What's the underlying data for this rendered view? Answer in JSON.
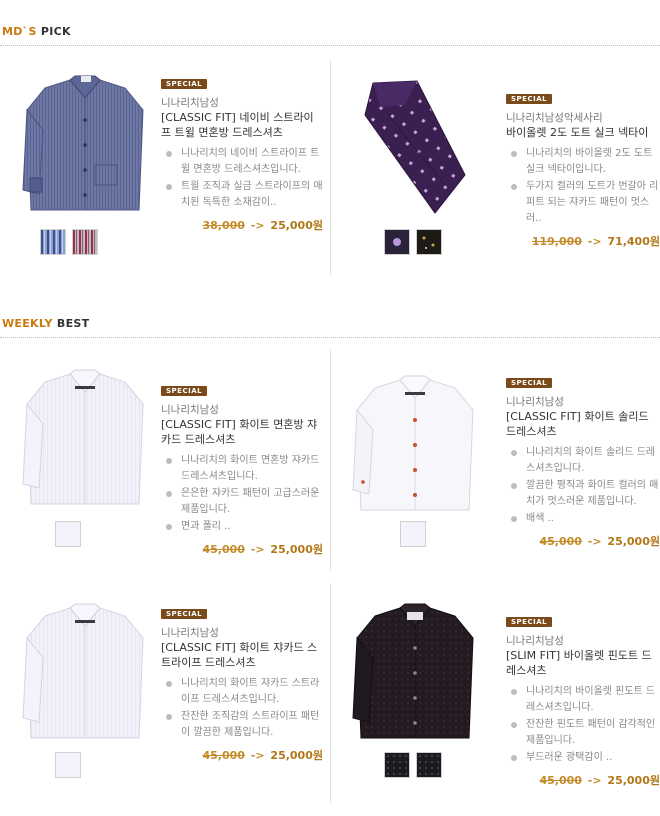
{
  "sections": {
    "mds_pick": {
      "accent": "MD`S",
      "rest": " PICK"
    },
    "weekly_best": {
      "accent": "WEEKLY",
      "rest": " BEST"
    }
  },
  "colors": {
    "accent": "#c8790f",
    "badge_bg": "#7a4a1a",
    "price": "#b17716"
  },
  "mds_pick": [
    {
      "badge": "SPECIAL",
      "brand": "니나리치남성",
      "name": "[CLASSIC FIT] 네이비 스트라이프 트윌 면혼방 드레스셔츠",
      "desc": [
        "니나리치의 네이비 스트라이프 트윌 면혼방 드레스셔츠입니다.",
        "트윌 조직과 실금 스트라이프의 매치된 독특한 소재감이.."
      ],
      "old_price": "38,000",
      "arrow": "->",
      "new_price": "25,000원",
      "image": "navy-stripe-shirt",
      "swatches": [
        "blue-stripe",
        "red-stripe"
      ]
    },
    {
      "badge": "SPECIAL",
      "brand": "니나리치남성악세사리",
      "name": "바이올렛 2도 도트 실크 넥타이",
      "desc": [
        "니나리치의 바이올렛 2도 도트 실크 넥타이입니다.",
        "두가지 컬러의 도트가 번갈아 리피트 되는 쟈카드 패턴이 멋스러.."
      ],
      "old_price": "119,000",
      "arrow": "->",
      "new_price": "71,400원",
      "image": "violet-dot-tie",
      "swatches": [
        "violet-dot",
        "gold-dot"
      ]
    }
  ],
  "weekly_best": [
    {
      "badge": "SPECIAL",
      "brand": "니나리치남성",
      "name": "[CLASSIC FIT] 화이트 면혼방 쟈카드 드레스셔츠",
      "desc": [
        "니나리치의 화이트 면혼방 쟈카드 드레스셔츠입니다.",
        "은은한 쟈카드 패턴이 고급스러운 제품입니다.",
        "면과 폴리 .."
      ],
      "old_price": "45,000",
      "arrow": "->",
      "new_price": "25,000원",
      "image": "white-jacquard-shirt",
      "swatches": [
        "white"
      ]
    },
    {
      "badge": "SPECIAL",
      "brand": "니나리치남성",
      "name": "[CLASSIC FIT] 화이트 솔리드 드레스셔츠",
      "desc": [
        "니나리치의 화이트 솔리드 드레스셔츠입니다.",
        "깔끔한 평직과 화이트 컬러의 매치가 멋스러운 제품입니다.",
        "배색 .."
      ],
      "old_price": "45,000",
      "arrow": "->",
      "new_price": "25,000원",
      "image": "white-solid-shirt",
      "swatches": [
        "white"
      ]
    },
    {
      "badge": "SPECIAL",
      "brand": "니나리치남성",
      "name": "[CLASSIC FIT] 화이트 쟈카드 스트라이프 드레스셔츠",
      "desc": [
        "니나리치의 화이트 쟈카드 스트라이프 드레스셔츠입니다.",
        "잔잔한 조직감의 스트라이프 패턴이 깔끔한 제품입니다."
      ],
      "old_price": "45,000",
      "arrow": "->",
      "new_price": "25,000원",
      "image": "white-stripe-shirt",
      "swatches": [
        "white"
      ]
    },
    {
      "badge": "SPECIAL",
      "brand": "니나리치남성",
      "name": "[SLIM FIT] 바이올렛 핀도트 드레스셔츠",
      "desc": [
        "니나리치의 바이올렛 핀도트 드레스셔츠입니다.",
        "잔잔한 핀도트 패턴이 감각적인 제품입니다.",
        "부드러운 광택감이 .."
      ],
      "old_price": "45,000",
      "arrow": "->",
      "new_price": "25,000원",
      "image": "black-pindot-shirt",
      "swatches": [
        "black-dot",
        "black-dot"
      ]
    }
  ]
}
